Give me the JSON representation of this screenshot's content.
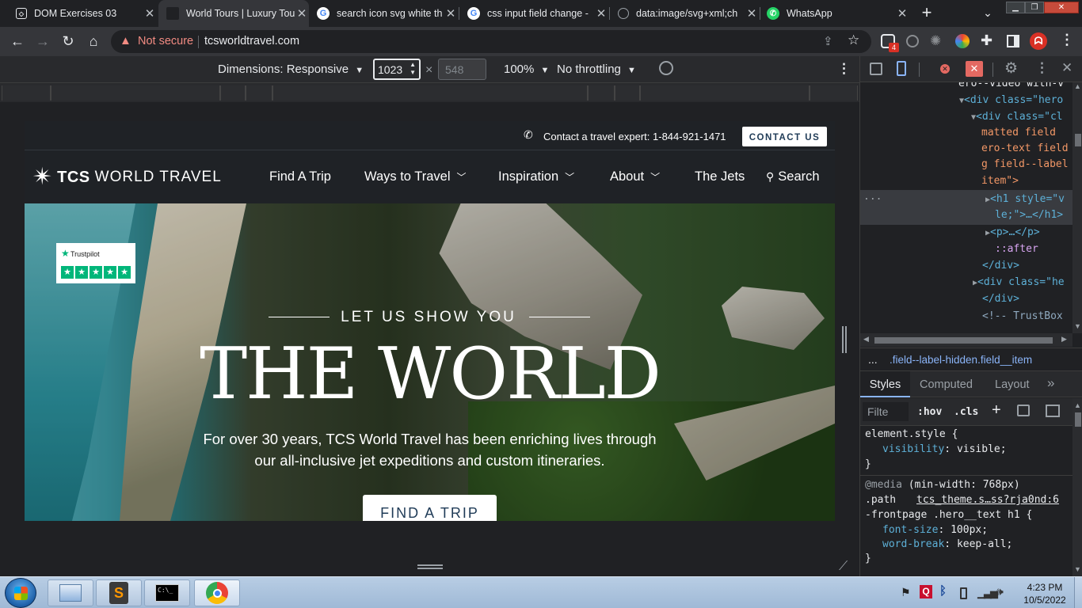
{
  "tabs": [
    {
      "title": "DOM Exercises 03",
      "active": false
    },
    {
      "title": "World Tours | Luxury Tou",
      "active": true
    },
    {
      "title": "search icon svg white th",
      "active": false
    },
    {
      "title": "css input field change -",
      "active": false
    },
    {
      "title": "data:image/svg+xml;ch",
      "active": false
    },
    {
      "title": "WhatsApp",
      "active": false
    }
  ],
  "address": {
    "security": "Not secure",
    "url": "tcsworldtravel.com"
  },
  "extension_badge": "4",
  "device_toolbar": {
    "dimensions": "Dimensions: Responsive",
    "width": "1023",
    "times": "×",
    "height_placeholder": "548",
    "zoom": "100%",
    "throttling": "No throttling"
  },
  "site": {
    "contact_text": "Contact a travel expert: 1-844-921-1471",
    "contact_button": "CONTACT US",
    "logo_tcs": "TCS",
    "logo_rest": "WORLD TRAVEL",
    "nav": [
      "Find A Trip",
      "Ways to Travel",
      "Inspiration",
      "About",
      "The Jets",
      "Search"
    ],
    "trustpilot": "Trustpilot",
    "eyebrow": "LET US SHOW YOU",
    "headline": "THE WORLD",
    "subtext_1": "For over 30 years, TCS World Travel has been enriching lives through",
    "subtext_2": "our all-inclusive jet expeditions and custom itineraries.",
    "cta": "FIND A TRIP"
  },
  "devtools": {
    "elements": [
      "ero--video with-v",
      "<div class=\"hero",
      "<div class=\"cl",
      "matted field",
      "ero-text field",
      "g field--label",
      "item\">",
      "<h1 style=\"v",
      "le;\">…</h1>",
      "<p>…</p>",
      "::after",
      "</div>",
      "<div class=\"he",
      "</div>",
      "<!-- TrustBox"
    ],
    "breadcrumb_dots": "...",
    "breadcrumb": ".field--label-hidden.field__item",
    "style_tabs": [
      "Styles",
      "Computed",
      "Layout"
    ],
    "more_tabs": "»",
    "filter_placeholder": "Filte",
    "hov": ":hov",
    "cls": ".cls",
    "rules": {
      "r1_selector": "element.style {",
      "r1_prop": "visibility",
      "r1_val": "visible;",
      "close": "}",
      "media": "@media",
      "media_query": "(min-width: 768px)",
      "r2_sel_a": ".path",
      "r2_link": "tcs_theme.s…ss?rja0nd:6",
      "r2_sel_b": "-frontpage .hero__text h1 {",
      "r2_p1": "font-size",
      "r2_v1": "100px;",
      "r2_p2": "word-break",
      "r2_v2": "keep-all;"
    }
  },
  "taskbar": {
    "time": "4:23 PM",
    "date": "10/5/2022"
  },
  "colors": {
    "accent_blue": "#8ab4f8",
    "warning_red": "#f28b82",
    "cta_navy": "#1f3b57",
    "whatsapp": "#25d366"
  }
}
